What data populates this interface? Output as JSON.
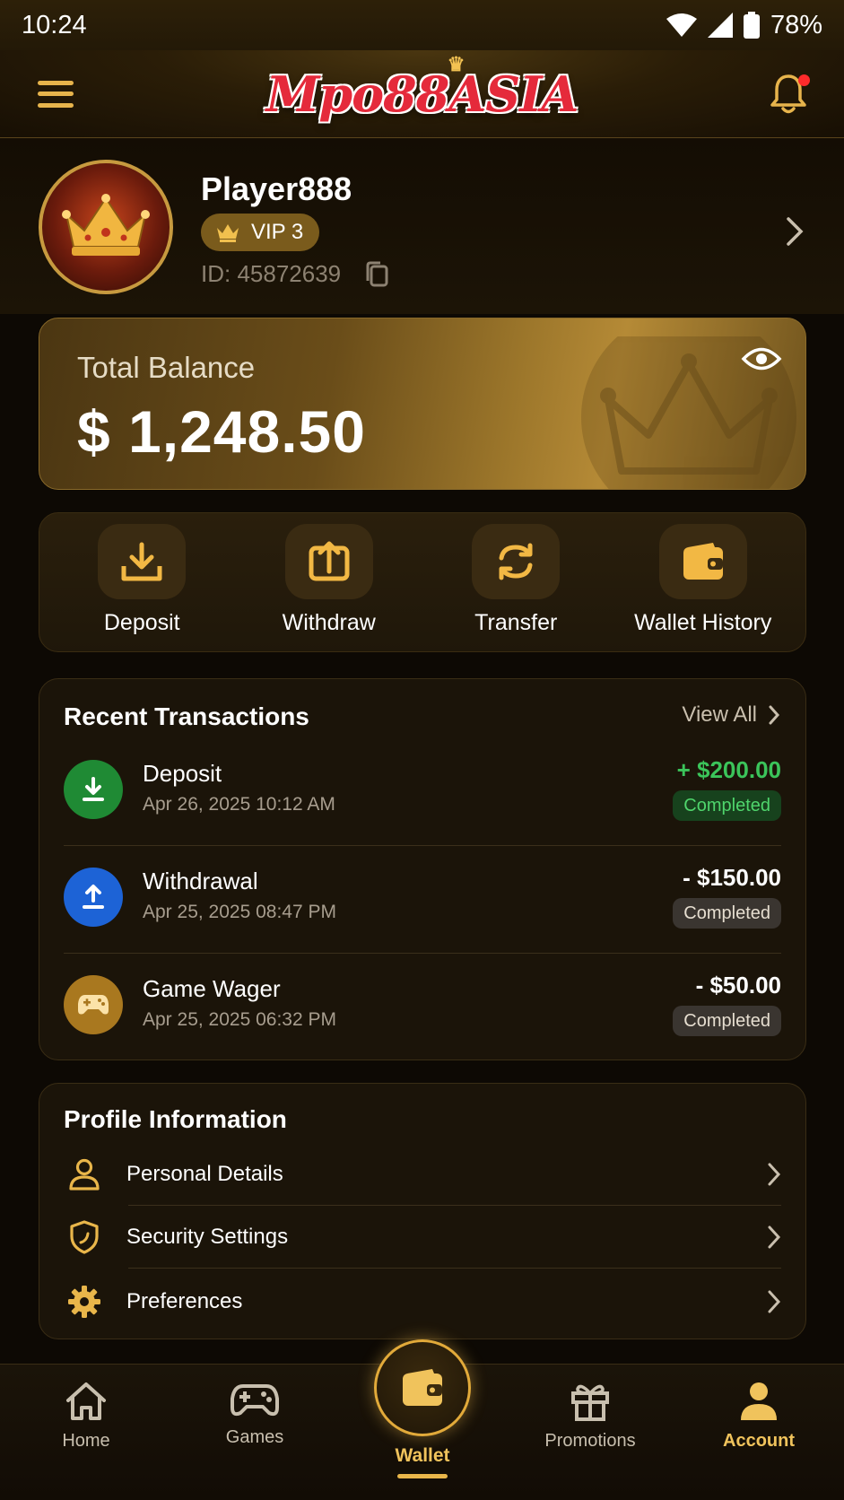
{
  "status_bar": {
    "time": "10:24",
    "battery": "78%"
  },
  "header": {
    "logo_text": "Mpo88ASIA",
    "notification_dot": true
  },
  "profile": {
    "username": "Player888",
    "vip": "VIP 3",
    "id_text": "ID: 45872639"
  },
  "balance": {
    "label": "Total Balance",
    "value": "$ 1,248.50"
  },
  "actions": [
    {
      "label": "Deposit",
      "icon": "download-icon"
    },
    {
      "label": "Withdraw",
      "icon": "upload-icon"
    },
    {
      "label": "Transfer",
      "icon": "transfer-icon"
    },
    {
      "label": "Wallet History",
      "icon": "wallet-icon"
    }
  ],
  "transactions": {
    "title": "Recent Transactions",
    "view_all": "View All",
    "items": [
      {
        "title": "Deposit",
        "date": "Apr 26, 2025 10:12 AM",
        "amount": "+ $200.00",
        "status": "Completed",
        "color": "#3bc45a"
      },
      {
        "title": "Withdrawal",
        "date": "Apr 25, 2025 08:47 PM",
        "amount": "- $150.00",
        "status": "Completed",
        "color": "#ffffff"
      },
      {
        "title": "Game Wager",
        "date": "Apr 25, 2025 06:32 PM",
        "amount": "- $50.00",
        "status": "Completed",
        "color": "#ffffff"
      }
    ]
  },
  "profile_info": {
    "title": "Profile Information",
    "items": [
      {
        "label": "Personal Details",
        "icon": "user-icon"
      },
      {
        "label": "Security Settings",
        "icon": "shield-icon"
      },
      {
        "label": "Preferences",
        "icon": "gear-icon"
      }
    ]
  },
  "bottom_nav": [
    {
      "label": "Home",
      "icon": "home-icon"
    },
    {
      "label": "Games",
      "icon": "gamepad-icon"
    },
    {
      "label": "Wallet",
      "icon": "wallet-icon",
      "active": true
    },
    {
      "label": "Promotions",
      "icon": "gift-icon"
    },
    {
      "label": "Account",
      "icon": "account-icon"
    }
  ],
  "colors": {
    "accent": "#e9b64a",
    "positive": "#3bc45a",
    "background": "#0d0904"
  }
}
